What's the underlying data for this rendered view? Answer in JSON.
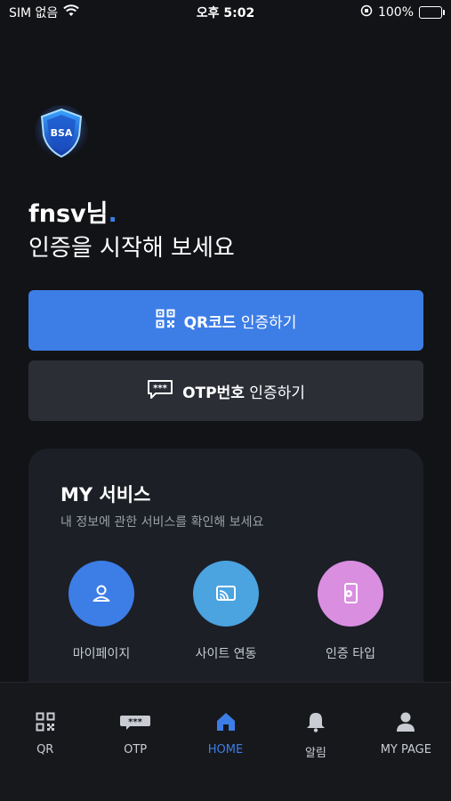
{
  "status_bar": {
    "carrier": "SIM 없음",
    "time": "오후 5:02",
    "battery": "100%"
  },
  "logo": {
    "text": "BSA"
  },
  "greeting": {
    "name": "fnsv님",
    "dot": ".",
    "subtitle": "인증을 시작해 보세요"
  },
  "actions": {
    "qr": {
      "bold": "QR코드",
      "label": " 인증하기"
    },
    "otp": {
      "bold": "OTP번호",
      "label": " 인증하기"
    }
  },
  "my_service": {
    "title": "MY 서비스",
    "description": "내 정보에 관한 서비스를 확인해 보세요",
    "items": [
      {
        "label": "마이페이지",
        "icon": "user-icon",
        "color": "#3d7de6"
      },
      {
        "label": "사이트 연동",
        "icon": "cast-icon",
        "color": "#4ba3e0"
      },
      {
        "label": "인증 타입",
        "icon": "phone-gear-icon",
        "color": "#d98ee0"
      }
    ]
  },
  "bottom_nav": {
    "items": [
      {
        "label": "QR",
        "icon": "qr-icon"
      },
      {
        "label": "OTP",
        "icon": "otp-icon"
      },
      {
        "label": "HOME",
        "icon": "home-icon",
        "active": true
      },
      {
        "label": "알림",
        "icon": "bell-icon"
      },
      {
        "label": "MY PAGE",
        "icon": "person-icon"
      }
    ]
  },
  "colors": {
    "accent": "#3d7de6",
    "background": "#121316",
    "card": "#1c1f26"
  }
}
